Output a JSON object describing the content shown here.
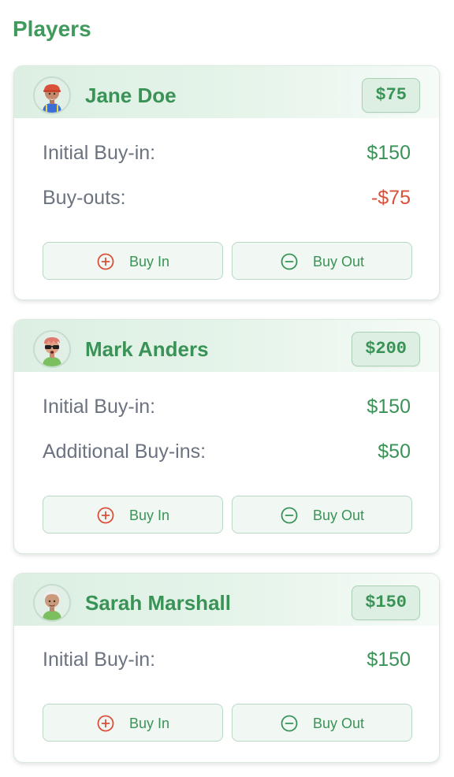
{
  "header": {
    "title": "Players"
  },
  "players": [
    {
      "name": "Jane Doe",
      "total": "$75",
      "rows": [
        {
          "label": "Initial Buy-in:",
          "value": "$150",
          "negative": false
        },
        {
          "label": "Buy-outs:",
          "value": "-$75",
          "negative": true
        }
      ]
    },
    {
      "name": "Mark Anders",
      "total": "$200",
      "rows": [
        {
          "label": "Initial Buy-in:",
          "value": "$150",
          "negative": false
        },
        {
          "label": "Additional Buy-ins:",
          "value": "$50",
          "negative": false
        }
      ]
    },
    {
      "name": "Sarah Marshall",
      "total": "$150",
      "rows": [
        {
          "label": "Initial Buy-in:",
          "value": "$150",
          "negative": false
        }
      ]
    }
  ],
  "actions": {
    "buy_in_label": "Buy In",
    "buy_out_label": "Buy Out",
    "buy_in_icon": "plus-circle-icon",
    "buy_out_icon": "minus-circle-icon"
  },
  "colors": {
    "accent": "#3a9356",
    "negative": "#d9503b",
    "label": "#6b7280",
    "buy_in_icon": "#d9503b",
    "buy_out_icon": "#3a9356"
  }
}
